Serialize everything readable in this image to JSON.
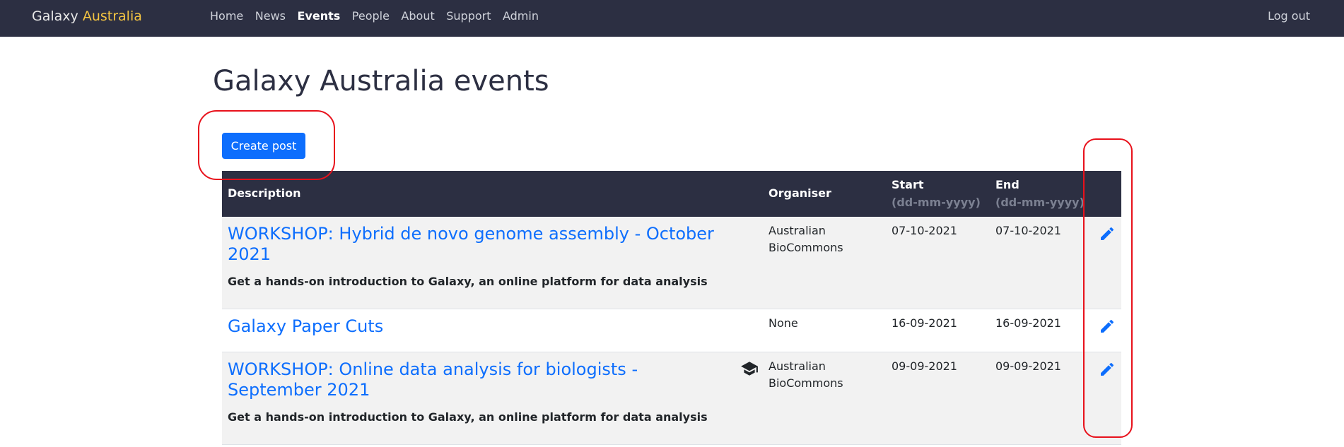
{
  "navbar": {
    "brand_main": "Galaxy",
    "brand_accent": "Australia",
    "links": [
      "Home",
      "News",
      "Events",
      "People",
      "About",
      "Support",
      "Admin"
    ],
    "active": "Events",
    "logout": "Log out"
  },
  "page": {
    "title": "Galaxy Australia events",
    "create_button": "Create post"
  },
  "table": {
    "headers": {
      "description": "Description",
      "organiser": "Organiser",
      "start": "Start",
      "start_format": "(dd-mm-yyyy)",
      "end": "End",
      "end_format": "(dd-mm-yyyy)"
    },
    "rows": [
      {
        "title": "WORKSHOP: Hybrid de novo genome assembly - October 2021",
        "description": "Get a hands-on introduction to Galaxy, an online platform for data analysis",
        "organiser": "Australian BioCommons",
        "start": "07-10-2021",
        "end": "07-10-2021",
        "icon": "graduation-cap-icon"
      },
      {
        "title": "Galaxy Paper Cuts",
        "description": "",
        "organiser": "None",
        "start": "16-09-2021",
        "end": "16-09-2021"
      },
      {
        "title": "WORKSHOP: Online data analysis for biologists - September 2021",
        "description": "Get a hands-on introduction to Galaxy, an online platform for data analysis",
        "organiser": "Australian BioCommons",
        "start": "09-09-2021",
        "end": "09-09-2021",
        "icon": "graduation-cap-icon"
      }
    ]
  },
  "colors": {
    "navbar": "#2c2f42",
    "accent": "#f5c542",
    "link": "#0d6efd",
    "highlight": "#e8111b"
  }
}
